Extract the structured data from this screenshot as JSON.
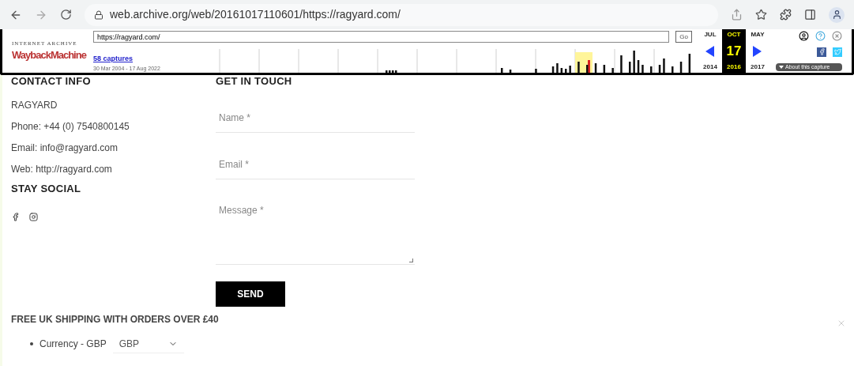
{
  "browser": {
    "url": "web.archive.org/web/20161017110601/https://ragyard.com/"
  },
  "wayback": {
    "logo_top": "INTERNET ARCHIVE",
    "logo": "WaybackMachine",
    "url_value": "https://ragyard.com/",
    "go": "Go",
    "captures": "58 captures",
    "date_range": "30 Mar 2004 - 17 Aug 2022",
    "months": [
      {
        "month": "JUL",
        "year": "2014",
        "selected": false
      },
      {
        "month": "OCT",
        "day": "17",
        "year": "2016",
        "selected": true
      },
      {
        "month": "MAY",
        "year": "2017",
        "selected": false
      }
    ],
    "about": "About this capture"
  },
  "contact": {
    "heading": "CONTACT INFO",
    "lines": [
      "RAGYARD",
      "Phone: +44 (0) 7540800145",
      "Email: info@ragyard.com",
      "Web: http://ragyard.com"
    ]
  },
  "social": {
    "heading": "STAY SOCIAL"
  },
  "form": {
    "heading": "GET IN TOUCH",
    "fields": [
      {
        "placeholder": "Name *",
        "kind": "input"
      },
      {
        "placeholder": "Email *",
        "kind": "input"
      },
      {
        "placeholder": "Message *",
        "kind": "textarea"
      }
    ],
    "submit": "SEND"
  },
  "footer": {
    "shipping": "FREE UK SHIPPING WITH ORDERS OVER £40",
    "currency_label": "Currency - GBP",
    "currency_value": "GBP"
  }
}
